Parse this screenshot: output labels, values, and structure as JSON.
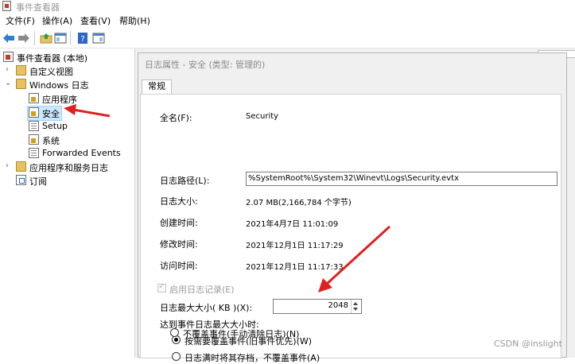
{
  "window": {
    "title": "事件查看器"
  },
  "menu": [
    "文件(F)",
    "操作(A)",
    "查看(V)",
    "帮助(H)"
  ],
  "tree": {
    "root": "事件查看器 (本地)",
    "custom_views": "自定义视图",
    "windows_logs": "Windows 日志",
    "logs": [
      "应用程序",
      "安全",
      "Setup",
      "系统",
      "Forwarded Events"
    ],
    "app_service_logs": "应用程序和服务日志",
    "subscriptions": "订阅"
  },
  "dialog": {
    "title": "日志属性 - 安全 (类型: 管理的)",
    "tab": "常规",
    "fields": {
      "full_name_label": "全名(F):",
      "full_name": "Security",
      "log_path_label": "日志路径(L):",
      "log_path": "%SystemRoot%\\System32\\Winevt\\Logs\\Security.evtx",
      "log_size_label": "日志大小:",
      "log_size": "2.07 MB(2,166,784 个字节)",
      "created_label": "创建时间:",
      "created": "2021年4月7日 11:01:09",
      "modified_label": "修改时间:",
      "modified": "2021年12月1日 11:17:29",
      "accessed_label": "访问时间:",
      "accessed": "2021年12月1日 11:17:33"
    },
    "enable_logging": "启用日志记录(E)",
    "max_size_label": "日志最大大小( KB )(X):",
    "max_size_value": "2048",
    "on_max_label": "达到事件日志最大大小时:",
    "options": [
      "按需要覆盖事件(旧事件优先)(W)",
      "日志满时将其存档，不覆盖事件(A)",
      "不覆盖事件(手动清除日志)(N)"
    ],
    "selected_option": 0
  },
  "watermark": "CSDN @inslight",
  "colors": {
    "arrow": "#e02020",
    "selection": "#cce8ff"
  }
}
